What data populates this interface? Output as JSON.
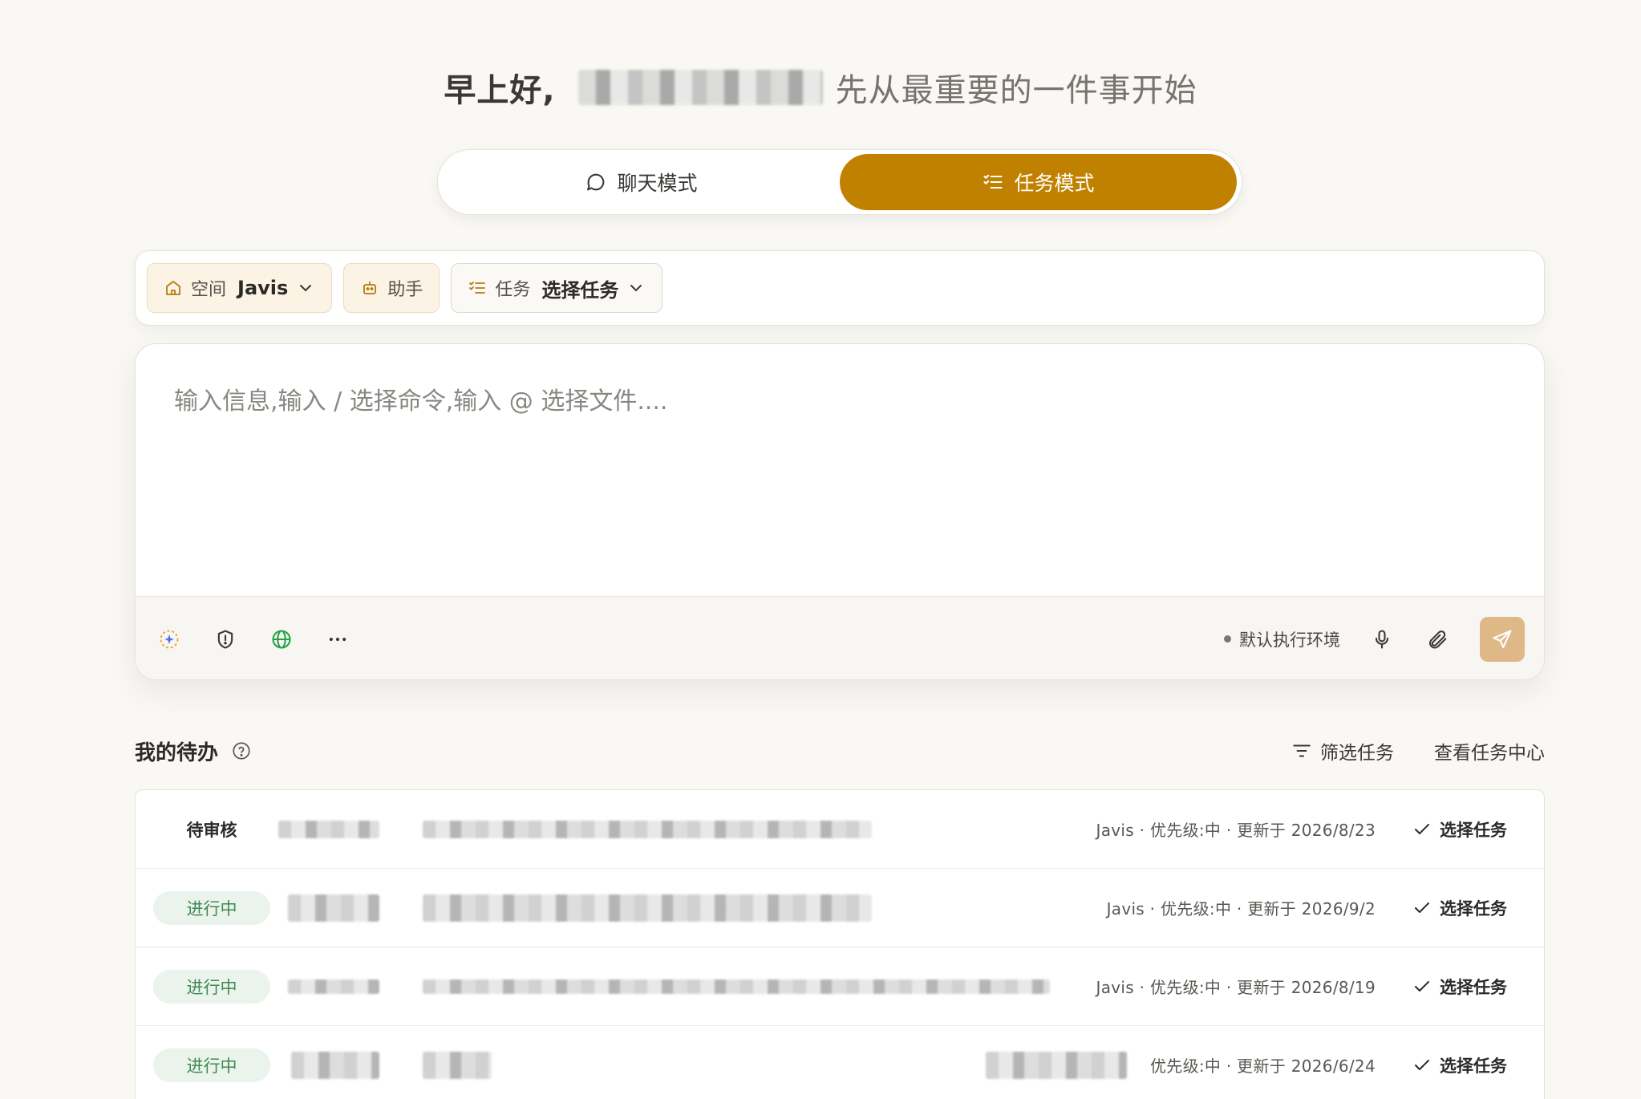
{
  "greeting": {
    "hello": "早上好,",
    "rest": "先从最重要的一件事开始"
  },
  "mode_switch": {
    "chat_label": "聊天模式",
    "task_label": "任务模式",
    "active": "task"
  },
  "context_bar": {
    "space_label": "空间",
    "space_value": "Javis",
    "assistant_label": "助手",
    "task_label": "任务",
    "task_value": "选择任务"
  },
  "composer": {
    "placeholder": "输入信息,输入 / 选择命令,输入 @ 选择文件....",
    "env_label": "默认执行环境"
  },
  "todo": {
    "title": "我的待办",
    "filter_label": "筛选任务",
    "view_center_label": "查看任务中心",
    "rows": [
      {
        "status": "待审核",
        "meta": "Javis · 优先级:中 · 更新于 2026/8/23",
        "action": "选择任务"
      },
      {
        "status": "进行中",
        "meta": "Javis · 优先级:中 · 更新于 2026/9/2",
        "action": "选择任务"
      },
      {
        "status": "进行中",
        "meta": "Javis · 优先级:中 · 更新于 2026/8/19",
        "action": "选择任务"
      },
      {
        "status": "进行中",
        "meta": "优先级:中 · 更新于 2026/6/24",
        "action": "选择任务"
      }
    ]
  },
  "colors": {
    "accent": "#c08000",
    "send_button": "#deb987",
    "progress_badge_bg": "#eaf3ec",
    "progress_badge_text": "#3f8a53",
    "globe_icon": "#22a447"
  },
  "icons": {
    "chat": "chat-bubble-icon",
    "task": "checklist-icon",
    "space": "home-icon",
    "assistant": "robot-icon",
    "sparkle": "sparkle-icon",
    "shield": "shield-icon",
    "globe": "globe-icon",
    "more": "more-dots-icon",
    "mic": "microphone-icon",
    "attach": "paperclip-icon",
    "send": "send-icon",
    "help": "help-circle-icon",
    "filter": "filter-icon",
    "check": "check-icon"
  }
}
